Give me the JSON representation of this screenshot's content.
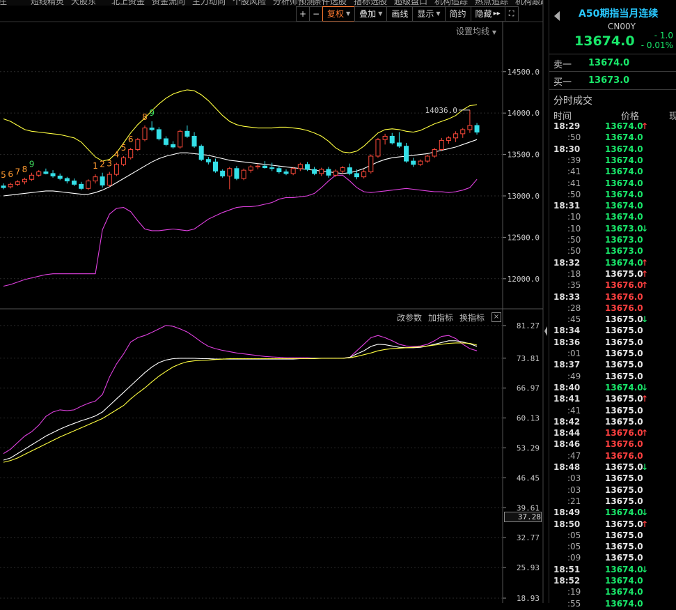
{
  "top_nav": [
    "短庄",
    "短线精灵",
    "大股东",
    "北上资金",
    "资金流向",
    "主力动向",
    "个股风险",
    "分析师预测",
    "条件选股",
    "指标选股",
    "超级盘口",
    "机构追踪",
    "热点追踪",
    "机构跟踪"
  ],
  "toolbar": {
    "plus": "+",
    "minus": "−",
    "fq": "复权",
    "overlay": "叠加",
    "draw": "画线",
    "display": "显示",
    "simple": "简约",
    "hide": "隐藏",
    "hide_arrows": "▸▸",
    "expand_icon": "fullscreen-icon"
  },
  "ma_settings": "设置均线",
  "sub_tools": {
    "params": "改参数",
    "add": "加指标",
    "switch": "换指标",
    "close": "×"
  },
  "crosshair_value": "37.28",
  "annotation_high": "14036.0",
  "chart_data": [
    {
      "type": "candlestick",
      "y_ticks": [
        14500.0,
        14000.0,
        13500.0,
        13000.0,
        12500.0,
        12000.0
      ],
      "ylim": [
        11830,
        14860
      ],
      "sequence_labels": [
        "5",
        "6",
        "7",
        "8",
        "9",
        "1",
        "2",
        "3",
        "4",
        "5",
        "6",
        "8",
        "9"
      ],
      "high_marker": 14036.0,
      "x": [
        0,
        1,
        2,
        3,
        4,
        5,
        6,
        7,
        8,
        9,
        10,
        11,
        12,
        13,
        14,
        15,
        16,
        17,
        18,
        19,
        20,
        21,
        22,
        23,
        24,
        25,
        26,
        27,
        28,
        29,
        30,
        31,
        32,
        33,
        34,
        35,
        36,
        37,
        38,
        39,
        40,
        41,
        42,
        43,
        44,
        45,
        46,
        47,
        48,
        49,
        50,
        51,
        52,
        53,
        54,
        55,
        56,
        57,
        58,
        59,
        60,
        61,
        62,
        63,
        64,
        65,
        66,
        67
      ],
      "ohlc": [
        [
          13120,
          13150,
          13080,
          13100
        ],
        [
          13110,
          13160,
          13090,
          13140
        ],
        [
          13140,
          13190,
          13120,
          13170
        ],
        [
          13170,
          13220,
          13140,
          13200
        ],
        [
          13200,
          13280,
          13180,
          13250
        ],
        [
          13250,
          13310,
          13230,
          13290
        ],
        [
          13290,
          13330,
          13260,
          13270
        ],
        [
          13270,
          13310,
          13220,
          13240
        ],
        [
          13240,
          13270,
          13190,
          13210
        ],
        [
          13210,
          13230,
          13150,
          13180
        ],
        [
          13180,
          13210,
          13120,
          13140
        ],
        [
          13140,
          13170,
          13070,
          13090
        ],
        [
          13090,
          13200,
          13070,
          13180
        ],
        [
          13180,
          13260,
          13150,
          13230
        ],
        [
          13230,
          13280,
          13100,
          13130
        ],
        [
          13130,
          13290,
          13110,
          13260
        ],
        [
          13260,
          13400,
          13240,
          13380
        ],
        [
          13380,
          13480,
          13360,
          13460
        ],
        [
          13460,
          13580,
          13440,
          13560
        ],
        [
          13560,
          13700,
          13540,
          13680
        ],
        [
          13680,
          13850,
          13660,
          13820
        ],
        [
          13820,
          13900,
          13780,
          13800
        ],
        [
          13800,
          13830,
          13670,
          13690
        ],
        [
          13690,
          13720,
          13600,
          13620
        ],
        [
          13620,
          13660,
          13570,
          13590
        ],
        [
          13590,
          13800,
          13570,
          13780
        ],
        [
          13780,
          13850,
          13700,
          13720
        ],
        [
          13720,
          13770,
          13580,
          13600
        ],
        [
          13600,
          13620,
          13420,
          13440
        ],
        [
          13440,
          13470,
          13380,
          13410
        ],
        [
          13410,
          13450,
          13280,
          13300
        ],
        [
          13300,
          13320,
          13220,
          13240
        ],
        [
          13240,
          13350,
          13080,
          13330
        ],
        [
          13330,
          13360,
          13190,
          13210
        ],
        [
          13210,
          13330,
          13190,
          13310
        ],
        [
          13310,
          13370,
          13280,
          13350
        ],
        [
          13350,
          13390,
          13320,
          13360
        ],
        [
          13360,
          13420,
          13330,
          13340
        ],
        [
          13340,
          13400,
          13300,
          13330
        ],
        [
          13330,
          13360,
          13270,
          13290
        ],
        [
          13290,
          13320,
          13250,
          13270
        ],
        [
          13270,
          13350,
          13250,
          13330
        ],
        [
          13330,
          13400,
          13300,
          13380
        ],
        [
          13380,
          13410,
          13300,
          13320
        ],
        [
          13320,
          13350,
          13250,
          13270
        ],
        [
          13270,
          13340,
          13240,
          13320
        ],
        [
          13320,
          13350,
          13220,
          13250
        ],
        [
          13250,
          13320,
          13230,
          13300
        ],
        [
          13300,
          13360,
          13270,
          13340
        ],
        [
          13340,
          13390,
          13250,
          13270
        ],
        [
          13270,
          13320,
          13200,
          13230
        ],
        [
          13230,
          13320,
          13210,
          13290
        ],
        [
          13290,
          13500,
          13270,
          13480
        ],
        [
          13480,
          13700,
          13460,
          13680
        ],
        [
          13680,
          13750,
          13620,
          13720
        ],
        [
          13720,
          13760,
          13620,
          13640
        ],
        [
          13640,
          13770,
          13580,
          13600
        ],
        [
          13600,
          13640,
          13400,
          13420
        ],
        [
          13420,
          13460,
          13350,
          13380
        ],
        [
          13380,
          13440,
          13360,
          13420
        ],
        [
          13420,
          13500,
          13400,
          13480
        ],
        [
          13480,
          13580,
          13460,
          13560
        ],
        [
          13560,
          13700,
          13540,
          13670
        ],
        [
          13670,
          13720,
          13630,
          13700
        ],
        [
          13700,
          13780,
          13650,
          13750
        ],
        [
          13750,
          13820,
          13700,
          13800
        ],
        [
          13800,
          14036,
          13760,
          13850
        ],
        [
          13850,
          13880,
          13740,
          13770
        ]
      ],
      "boll_upper": [
        13930,
        13900,
        13850,
        13800,
        13780,
        13770,
        13760,
        13750,
        13740,
        13720,
        13700,
        13650,
        13560,
        13470,
        13420,
        13440,
        13520,
        13640,
        13760,
        13860,
        13940,
        14030,
        14110,
        14180,
        14230,
        14260,
        14280,
        14270,
        14220,
        14150,
        14060,
        13970,
        13900,
        13860,
        13840,
        13830,
        13820,
        13820,
        13820,
        13830,
        13830,
        13820,
        13810,
        13790,
        13760,
        13720,
        13660,
        13580,
        13530,
        13520,
        13540,
        13600,
        13680,
        13760,
        13800,
        13810,
        13800,
        13780,
        13770,
        13790,
        13830,
        13870,
        13900,
        13930,
        13970,
        14040,
        14090,
        14100
      ],
      "boll_middle": [
        13000,
        13010,
        13020,
        13030,
        13040,
        13050,
        13060,
        13060,
        13050,
        13040,
        13030,
        13020,
        13020,
        13040,
        13070,
        13110,
        13160,
        13210,
        13260,
        13310,
        13360,
        13410,
        13450,
        13480,
        13500,
        13520,
        13520,
        13510,
        13500,
        13490,
        13470,
        13450,
        13430,
        13420,
        13410,
        13400,
        13390,
        13380,
        13370,
        13360,
        13350,
        13340,
        13330,
        13320,
        13310,
        13300,
        13290,
        13280,
        13270,
        13280,
        13300,
        13330,
        13370,
        13410,
        13440,
        13460,
        13470,
        13480,
        13490,
        13500,
        13510,
        13530,
        13550,
        13570,
        13590,
        13620,
        13650,
        13680
      ],
      "boll_lower": [
        11910,
        11930,
        11960,
        11990,
        12010,
        12030,
        12050,
        12060,
        12060,
        12060,
        12060,
        12060,
        12060,
        12060,
        12590,
        12780,
        12850,
        12860,
        12810,
        12700,
        12600,
        12580,
        12580,
        12590,
        12600,
        12590,
        12580,
        12600,
        12660,
        12720,
        12760,
        12800,
        12830,
        12860,
        12870,
        12870,
        12880,
        12900,
        12920,
        12960,
        12980,
        12980,
        12990,
        13000,
        13030,
        13100,
        13180,
        13250,
        13250,
        13180,
        13100,
        13050,
        13040,
        13050,
        13060,
        13070,
        13080,
        13090,
        13080,
        13070,
        13060,
        13050,
        13050,
        13040,
        13050,
        13070,
        13100,
        13200
      ]
    },
    {
      "type": "line",
      "y_ticks": [
        81.27,
        73.81,
        66.97,
        60.13,
        53.29,
        46.45,
        39.61,
        32.77,
        25.93,
        18.93
      ],
      "ylim": [
        18.93,
        81.27
      ],
      "series": [
        {
          "color": "#e040e0",
          "values": [
            52.0,
            53.0,
            54.5,
            56.0,
            57.0,
            58.5,
            60.5,
            61.5,
            62.0,
            61.8,
            62.0,
            62.8,
            63.5,
            64.0,
            65.5,
            69.5,
            72.5,
            74.8,
            77.5,
            78.5,
            79.0,
            79.7,
            80.5,
            81.3,
            81.1,
            80.5,
            79.8,
            78.7,
            77.5,
            76.5,
            76.0,
            75.6,
            75.3,
            75.0,
            74.8,
            74.6,
            74.4,
            74.2,
            74.1,
            74.0,
            73.9,
            73.9,
            73.9,
            73.9,
            73.8,
            73.8,
            73.8,
            73.8,
            73.8,
            74.0,
            75.5,
            77.0,
            78.5,
            79.0,
            78.5,
            77.8,
            77.0,
            76.6,
            76.5,
            76.6,
            77.0,
            77.8,
            78.8,
            79.0,
            78.3,
            77.0,
            76.0,
            75.5
          ]
        },
        {
          "color": "#ffffff",
          "values": [
            50.5,
            51.0,
            52.0,
            53.0,
            54.0,
            55.0,
            56.0,
            56.8,
            57.6,
            58.3,
            58.9,
            59.5,
            60.0,
            60.6,
            61.5,
            63.0,
            64.5,
            66.0,
            67.5,
            69.0,
            70.5,
            71.8,
            72.8,
            73.4,
            73.7,
            73.8,
            73.8,
            73.8,
            73.7,
            73.7,
            73.6,
            73.6,
            73.6,
            73.6,
            73.6,
            73.6,
            73.6,
            73.6,
            73.6,
            73.6,
            73.6,
            73.6,
            73.7,
            73.7,
            73.8,
            73.8,
            73.8,
            73.8,
            73.8,
            74.0,
            74.8,
            75.5,
            76.5,
            77.0,
            76.9,
            76.6,
            76.3,
            76.2,
            76.2,
            76.3,
            76.6,
            77.0,
            77.4,
            77.8,
            77.8,
            77.5,
            77.1,
            76.5
          ]
        },
        {
          "color": "#ffff40",
          "values": [
            50.0,
            50.4,
            51.0,
            51.8,
            52.6,
            53.4,
            54.2,
            55.0,
            55.8,
            56.5,
            57.2,
            57.9,
            58.6,
            59.3,
            60.0,
            61.0,
            62.0,
            63.0,
            64.5,
            65.8,
            67.0,
            68.4,
            69.7,
            70.8,
            71.8,
            72.5,
            73.0,
            73.2,
            73.3,
            73.4,
            73.5,
            73.6,
            73.7,
            73.7,
            73.7,
            73.7,
            73.7,
            73.7,
            73.7,
            73.7,
            73.7,
            73.7,
            73.7,
            73.7,
            73.7,
            73.8,
            73.8,
            73.8,
            73.8,
            73.9,
            74.2,
            74.6,
            75.0,
            75.5,
            75.8,
            76.0,
            76.1,
            76.2,
            76.3,
            76.4,
            76.6,
            76.8,
            77.0,
            77.2,
            77.3,
            77.3,
            77.2,
            76.8
          ]
        }
      ]
    }
  ],
  "panel": {
    "title": "A50期指当月连续",
    "code": "CN00Y",
    "price": "13674.0",
    "change": "- 1.0",
    "change_pct": "- 0.01%",
    "sell_label": "卖一",
    "sell_value": "13674.0",
    "buy_label": "买一",
    "buy_value": "13673.0",
    "section": "分时成交",
    "col_time": "时间",
    "col_price": "价格",
    "col_vol": "现",
    "colors": {
      "up": "#ff4040",
      "down": "#19e86a",
      "flat": "#e8e8e8"
    },
    "ticks": [
      {
        "t": "18:29",
        "p": "13674.0",
        "c": "g",
        "a": "up"
      },
      {
        "t": ":50",
        "p": "13674.0",
        "c": "g",
        "a": ""
      },
      {
        "t": "18:30",
        "p": "13674.0",
        "c": "g",
        "a": ""
      },
      {
        "t": ":39",
        "p": "13674.0",
        "c": "g",
        "a": ""
      },
      {
        "t": ":41",
        "p": "13674.0",
        "c": "g",
        "a": ""
      },
      {
        "t": ":41",
        "p": "13674.0",
        "c": "g",
        "a": ""
      },
      {
        "t": ":50",
        "p": "13674.0",
        "c": "g",
        "a": ""
      },
      {
        "t": "18:31",
        "p": "13674.0",
        "c": "g",
        "a": ""
      },
      {
        "t": ":10",
        "p": "13674.0",
        "c": "g",
        "a": ""
      },
      {
        "t": ":10",
        "p": "13673.0",
        "c": "g",
        "a": "down"
      },
      {
        "t": ":50",
        "p": "13673.0",
        "c": "g",
        "a": ""
      },
      {
        "t": ":50",
        "p": "13673.0",
        "c": "g",
        "a": ""
      },
      {
        "t": "18:32",
        "p": "13674.0",
        "c": "g",
        "a": "up"
      },
      {
        "t": ":18",
        "p": "13675.0",
        "c": "w",
        "a": "up"
      },
      {
        "t": ":35",
        "p": "13676.0",
        "c": "r",
        "a": "up"
      },
      {
        "t": "18:33",
        "p": "13676.0",
        "c": "r",
        "a": ""
      },
      {
        "t": ":28",
        "p": "13676.0",
        "c": "r",
        "a": ""
      },
      {
        "t": ":45",
        "p": "13675.0",
        "c": "w",
        "a": "down"
      },
      {
        "t": "18:34",
        "p": "13675.0",
        "c": "w",
        "a": ""
      },
      {
        "t": "18:36",
        "p": "13675.0",
        "c": "w",
        "a": ""
      },
      {
        "t": ":01",
        "p": "13675.0",
        "c": "w",
        "a": ""
      },
      {
        "t": "18:37",
        "p": "13675.0",
        "c": "w",
        "a": ""
      },
      {
        "t": ":49",
        "p": "13675.0",
        "c": "w",
        "a": ""
      },
      {
        "t": "18:40",
        "p": "13674.0",
        "c": "g",
        "a": "down"
      },
      {
        "t": "18:41",
        "p": "13675.0",
        "c": "w",
        "a": "up"
      },
      {
        "t": ":41",
        "p": "13675.0",
        "c": "w",
        "a": ""
      },
      {
        "t": "18:42",
        "p": "13675.0",
        "c": "w",
        "a": ""
      },
      {
        "t": "18:44",
        "p": "13676.0",
        "c": "r",
        "a": "up"
      },
      {
        "t": "18:46",
        "p": "13676.0",
        "c": "r",
        "a": ""
      },
      {
        "t": ":47",
        "p": "13676.0",
        "c": "r",
        "a": ""
      },
      {
        "t": "18:48",
        "p": "13675.0",
        "c": "w",
        "a": "down"
      },
      {
        "t": ":03",
        "p": "13675.0",
        "c": "w",
        "a": ""
      },
      {
        "t": ":03",
        "p": "13675.0",
        "c": "w",
        "a": ""
      },
      {
        "t": ":21",
        "p": "13675.0",
        "c": "w",
        "a": ""
      },
      {
        "t": "18:49",
        "p": "13674.0",
        "c": "g",
        "a": "down"
      },
      {
        "t": "18:50",
        "p": "13675.0",
        "c": "w",
        "a": "up"
      },
      {
        "t": ":05",
        "p": "13675.0",
        "c": "w",
        "a": ""
      },
      {
        "t": ":05",
        "p": "13675.0",
        "c": "w",
        "a": ""
      },
      {
        "t": ":09",
        "p": "13675.0",
        "c": "w",
        "a": ""
      },
      {
        "t": "18:51",
        "p": "13674.0",
        "c": "g",
        "a": "down"
      },
      {
        "t": "18:52",
        "p": "13674.0",
        "c": "g",
        "a": ""
      },
      {
        "t": ":19",
        "p": "13674.0",
        "c": "g",
        "a": ""
      },
      {
        "t": ":55",
        "p": "13674.0",
        "c": "g",
        "a": ""
      }
    ]
  }
}
